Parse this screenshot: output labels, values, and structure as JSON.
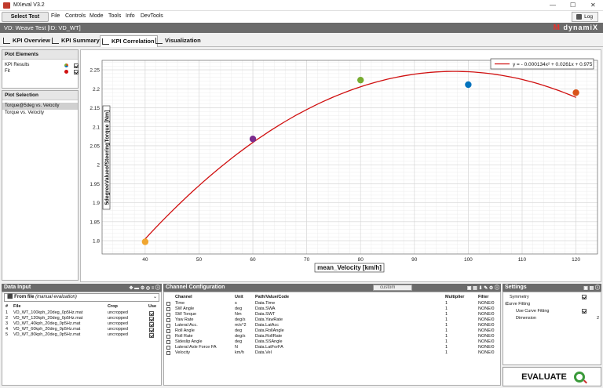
{
  "app": {
    "title": "MXeval V3.2"
  },
  "menubar": {
    "select_test": "Select Test",
    "items": [
      "File",
      "Controls",
      "Mode",
      "Tools",
      "Info",
      "DevTools"
    ],
    "log": "Log"
  },
  "vdbar": {
    "text": "VD: Weave Test   [ID: VD_WT]",
    "logo_m": "M",
    "logo_text": "dynamiX"
  },
  "tabs": [
    "KPI Overview",
    "KPI Summary",
    "KPI Correlation",
    "Visualization"
  ],
  "plot_elements": {
    "header": "Plot Elements",
    "items": [
      {
        "label": "KPI Results",
        "checked": true
      },
      {
        "label": "Fit",
        "checked": true
      }
    ]
  },
  "plot_selection": {
    "header": "Plot Selection",
    "items": [
      "Torque@5deg vs. Velocity",
      "Torque vs. Velocity"
    ],
    "selected": 0
  },
  "chart_data": {
    "type": "scatter",
    "xlabel": "mean_Velocity [km/h]",
    "ylabel": "5degreeValueofSteeringTorque [Nm]",
    "xlim": [
      32,
      124
    ],
    "ylim": [
      1.765,
      2.275
    ],
    "xticks": [
      40,
      50,
      60,
      70,
      80,
      90,
      100,
      110,
      120
    ],
    "yticks": [
      1.8,
      1.85,
      1.9,
      1.95,
      2,
      2.05,
      2.1,
      2.15,
      2.2,
      2.25
    ],
    "ytick_labels": [
      "1.8",
      "1.85",
      "1.9",
      "1.95",
      "2",
      "2.05",
      "2.1",
      "2.15",
      "2.2",
      "2.25"
    ],
    "grid": true,
    "points": [
      {
        "x": 40,
        "y": 1.797,
        "color": "#f0a630"
      },
      {
        "x": 60,
        "y": 2.068,
        "color": "#7b2d8e"
      },
      {
        "x": 80,
        "y": 2.223,
        "color": "#77ac30"
      },
      {
        "x": 100,
        "y": 2.211,
        "color": "#0072bd"
      },
      {
        "x": 120,
        "y": 2.19,
        "color": "#d95319"
      }
    ],
    "fit": {
      "a": -0.000134,
      "b": 0.0261,
      "c": 0.975,
      "color": "#d01010"
    },
    "legend": {
      "text": "y = - 0.000134x² + 0.0261x + 0.975",
      "position": "top-right"
    }
  },
  "data_input": {
    "header": "Data Input",
    "source": "From file",
    "source_note": "(manual evaluation)",
    "columns": [
      "#",
      "File",
      "Crop",
      "Use"
    ],
    "rows": [
      {
        "n": "1",
        "file": "VD_WT_100kph_20deg_0p5Hz.mat",
        "crop": "uncropped",
        "use": true
      },
      {
        "n": "2",
        "file": "VD_WT_120kph_20deg_0p5Hz.mat",
        "crop": "uncropped",
        "use": true
      },
      {
        "n": "3",
        "file": "VD_WT_40kph_20deg_0p5Hz.mat",
        "crop": "uncropped",
        "use": true
      },
      {
        "n": "4",
        "file": "VD_WT_60kph_20deg_0p5Hz.mat",
        "crop": "uncropped",
        "use": true
      },
      {
        "n": "5",
        "file": "VD_WT_80kph_20deg_0p5Hz.mat",
        "crop": "uncropped",
        "use": true
      }
    ]
  },
  "channel_config": {
    "header": "Channel Configuration",
    "custom_label": "custom",
    "columns": [
      "Channel",
      "Unit",
      "Path/Value/Code",
      "Multiplier",
      "Filter"
    ],
    "rows": [
      {
        "channel": "Time",
        "unit": "s",
        "path": "Data.Time",
        "mult": "1",
        "filter": "NONE/0"
      },
      {
        "channel": "SW Angle",
        "unit": "deg",
        "path": "Data.SWA",
        "mult": "1",
        "filter": "NONE/0"
      },
      {
        "channel": "SW Torque",
        "unit": "Nm",
        "path": "Data.SWT",
        "mult": "1",
        "filter": "NONE/0"
      },
      {
        "channel": "Yaw Rate",
        "unit": "deg/s",
        "path": "Data.YawRate",
        "mult": "1",
        "filter": "NONE/0"
      },
      {
        "channel": "Lateral Acc.",
        "unit": "m/s^2",
        "path": "Data.LatAcc",
        "mult": "1",
        "filter": "NONE/0"
      },
      {
        "channel": "Roll Angle",
        "unit": "deg",
        "path": "Data.RollAngle",
        "mult": "1",
        "filter": "NONE/0"
      },
      {
        "channel": "Roll Rate",
        "unit": "deg/s",
        "path": "Data.RollRate",
        "mult": "1",
        "filter": "NONE/0"
      },
      {
        "channel": "Sideslip Angle",
        "unit": "deg",
        "path": "Data.SSAngle",
        "mult": "1",
        "filter": "NONE/0"
      },
      {
        "channel": "Lateral Axle Force FA",
        "unit": "N",
        "path": "Data.LatForFA",
        "mult": "1",
        "filter": "NONE/0"
      },
      {
        "channel": "Velocity",
        "unit": "km/h",
        "path": "Data.Vel",
        "mult": "1",
        "filter": "NONE/0"
      }
    ]
  },
  "settings": {
    "header": "Settings",
    "rows": [
      {
        "label": "Symmetry",
        "value": "",
        "check": true,
        "indent": 0
      },
      {
        "label": "Curve Fitting",
        "value": "",
        "check": null,
        "indent": 0,
        "group": true
      },
      {
        "label": "Use Curve Fitting",
        "value": "",
        "check": true,
        "indent": 1
      },
      {
        "label": "Dimension",
        "value": "2",
        "check": null,
        "indent": 1
      }
    ]
  },
  "evaluate": {
    "label": "EVALUATE"
  }
}
